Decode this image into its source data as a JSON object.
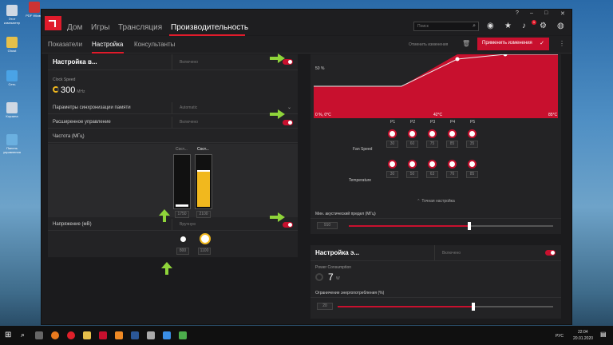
{
  "desktop": {
    "icons": [
      {
        "label": "Этот компьютер"
      },
      {
        "label": "Ghost"
      },
      {
        "label": "Сеть"
      },
      {
        "label": "Корзина"
      },
      {
        "label": "Панель управления"
      }
    ],
    "top_left_app": "PDF Wizard"
  },
  "app": {
    "nav": [
      "Дом",
      "Игры",
      "Трансляция",
      "Производительность"
    ],
    "search_placeholder": "Поиск",
    "notification_count": "1",
    "subtabs": [
      "Показатели",
      "Настройка",
      "Консультанты"
    ],
    "discard_label": "Отменить изменения",
    "apply_label": "Применить изменения",
    "accent": "#e01b2b"
  },
  "gpu_tuning": {
    "title": "Настройка в...",
    "title_value": "Включено",
    "clock_label": "Clock Speed",
    "clock_value": "300",
    "clock_unit": "MHz",
    "mem_timing_label": "Параметры синхронизации памяти",
    "mem_timing_value": "Automatic",
    "advanced_label": "Расширенное управление",
    "advanced_value": "Включено",
    "frequency_label": "Частота (МГц)",
    "states": [
      {
        "label": "Сост...",
        "value": "1750",
        "fill": 0.05
      },
      {
        "label": "Сост...",
        "value": "2100",
        "fill": 0.72
      }
    ],
    "voltage_label": "Напряжение (мВ)",
    "voltage_value": "Вручную",
    "voltage_states": [
      "800",
      "1100"
    ]
  },
  "fan": {
    "chart_labels": {
      "pct": "50 %",
      "left": "0 %, 0°C",
      "mid": "42°C",
      "right": "85°C"
    },
    "points": [
      "P1",
      "P2",
      "P3",
      "P4",
      "P5"
    ],
    "speed_label": "Fan Speed",
    "speeds": [
      "30",
      "60",
      "75",
      "85",
      "35"
    ],
    "temp_label": "Temperature",
    "temps": [
      "30",
      "50",
      "63",
      "76",
      "85"
    ],
    "fine_tune_label": "Точная настройка",
    "min_acoustic_label": "Мин. акустический предел (МГц)",
    "min_acoustic_value": "910",
    "min_acoustic_fraction": 0.59
  },
  "power": {
    "title": "Настройка э...",
    "title_value": "Включено",
    "consumption_label": "Power Consumption",
    "consumption_value": "7",
    "consumption_unit": "W",
    "limit_label": "Ограничение энергопотребления (%)",
    "limit_value": "20",
    "limit_fraction": 0.63
  },
  "taskbar": {
    "lang": "РУС",
    "time": "22:04",
    "date": "20.01.2020"
  }
}
